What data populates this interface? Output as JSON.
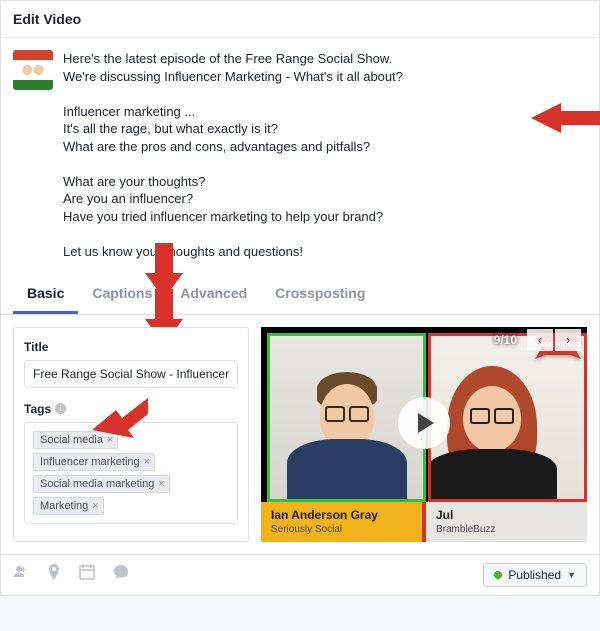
{
  "header": {
    "title": "Edit Video"
  },
  "post": {
    "text": "Here's the latest episode of the Free Range Social Show.\nWe're discussing Influencer Marketing - What's it all about?\n\nInfluencer marketing ...\nIt's all the rage, but what exactly is it?\nWhat are the pros and cons, advantages and pitfalls?\n\nWhat are your thoughts?\nAre you an influencer?\nHave you tried influencer marketing to help your brand?\n\nLet us know your thoughts and questions!"
  },
  "tabs": {
    "items": [
      "Basic",
      "Captions",
      "Advanced",
      "Crossposting"
    ],
    "active": 0
  },
  "form": {
    "title_label": "Title",
    "title_value": "Free Range Social Show - Influencer marketi",
    "tags_label": "Tags",
    "tags": [
      "Social media",
      "Influencer marketing",
      "Social media marketing",
      "Marketing"
    ]
  },
  "preview": {
    "index": "9/10",
    "people": [
      {
        "name": "Ian Anderson Gray",
        "org": "Seriously Social"
      },
      {
        "name": "Jul",
        "org": "BrambleBuzz"
      }
    ]
  },
  "footer": {
    "status_label": "Published"
  }
}
